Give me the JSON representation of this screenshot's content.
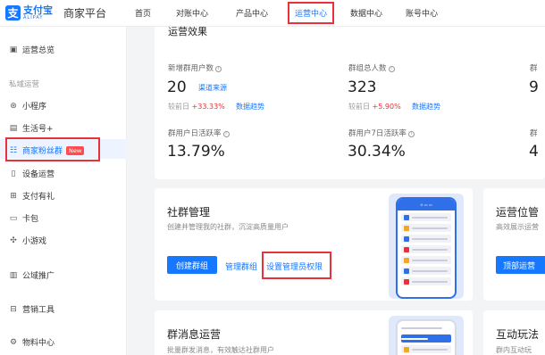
{
  "header": {
    "logo_glyph": "支",
    "logo_cn": "支付宝",
    "logo_en": "ALIPAY",
    "platform": "商家平台",
    "nav": [
      "首页",
      "对账中心",
      "产品中心",
      "运营中心",
      "数据中心",
      "账号中心"
    ],
    "active_nav": "运营中心"
  },
  "sidebar": {
    "overview": "运营总览",
    "group_private": "私域运营",
    "items": [
      "小程序",
      "生活号+",
      "商家粉丝群",
      "设备运营",
      "支付有礼",
      "卡包",
      "小游戏"
    ],
    "new_badge": "New",
    "promotion": "公域推广",
    "marketing": "营销工具",
    "materials": "物料中心"
  },
  "effect": {
    "title": "运营效果",
    "metrics": [
      {
        "label": "新增群用户数",
        "value": "20",
        "link": "渠道来源",
        "compare_label": "较前日",
        "compare_value": "+33.33%",
        "trend": "数据趋势"
      },
      {
        "label": "群组总人数",
        "value": "323",
        "compare_label": "较前日",
        "compare_value": "+5.90%",
        "trend": "数据趋势"
      },
      {
        "label": "群用户日活跃率",
        "value": "13.79%"
      },
      {
        "label": "群用户7日活跃率",
        "value": "30.34%"
      }
    ],
    "partial_right_top": "群",
    "partial_right_value": "9",
    "partial_right_mid": "群",
    "partial_right_value2": "4"
  },
  "community": {
    "title": "社群管理",
    "desc": "创建并管理我的社群，沉淀高质量用户",
    "create": "创建群组",
    "manage": "管理群组",
    "admin": "设置管理员权限"
  },
  "ops_position": {
    "title": "运营位管",
    "desc": "高效展示运营",
    "button": "顶部运营"
  },
  "group_message": {
    "title": "群消息运营",
    "desc": "批量群发消息，有效触达社群用户"
  },
  "interactive": {
    "title": "互动玩法",
    "desc": "群内互动玩"
  },
  "colors": {
    "accent": "#1677ff",
    "highlight": "#e8313a"
  }
}
